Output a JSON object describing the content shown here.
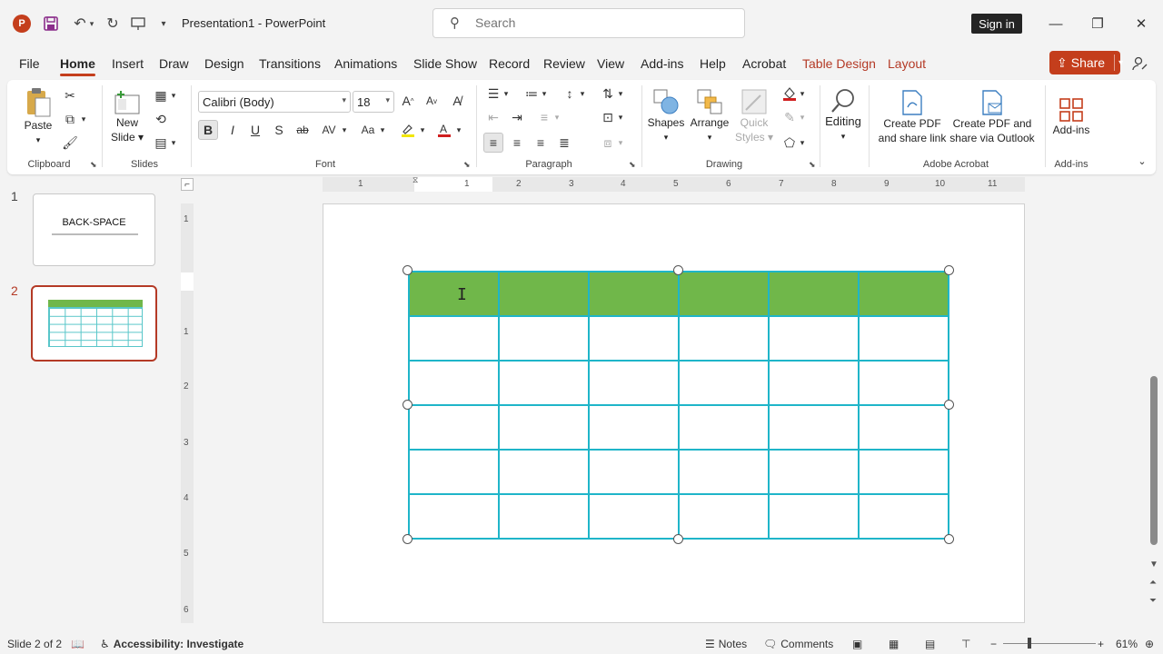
{
  "app": {
    "doc_title": "Presentation1  -  PowerPoint",
    "search_placeholder": "Search",
    "sign_in": "Sign in"
  },
  "tabs": [
    "File",
    "Home",
    "Insert",
    "Draw",
    "Design",
    "Transitions",
    "Animations",
    "Slide Show",
    "Record",
    "Review",
    "View",
    "Add-ins",
    "Help",
    "Acrobat",
    "Table Design",
    "Layout"
  ],
  "active_tab": "Home",
  "share_label": "Share",
  "ribbon": {
    "clipboard": {
      "paste": "Paste",
      "label": "Clipboard"
    },
    "slides": {
      "new_slide": "New",
      "new_slide2": "Slide",
      "label": "Slides"
    },
    "font": {
      "font_name": "Calibri (Body)",
      "font_size": "18",
      "bold": "B",
      "italic": "I",
      "underline": "U",
      "strike": "S",
      "abc": "ab",
      "spacing": "AV",
      "case": "Aa",
      "label": "Font"
    },
    "paragraph": {
      "label": "Paragraph"
    },
    "drawing": {
      "shapes": "Shapes",
      "arrange": "Arrange",
      "quick": "Quick",
      "styles": "Styles",
      "label": "Drawing"
    },
    "editing": {
      "editing": "Editing"
    },
    "acrobat": {
      "create_pdf_1": "Create PDF",
      "create_pdf_2": "and share link",
      "create_pdf_outlook_1": "Create PDF and",
      "create_pdf_outlook_2": "share via Outlook",
      "label": "Adobe Acrobat"
    },
    "addins": {
      "addins": "Add-ins",
      "label": "Add-ins"
    }
  },
  "thumbnails": [
    {
      "num": "1",
      "title": "BACK-SPACE"
    },
    {
      "num": "2"
    }
  ],
  "ruler_h": [
    "1",
    "1",
    "2",
    "3",
    "4",
    "5",
    "6",
    "7",
    "8",
    "9",
    "10",
    "11"
  ],
  "ruler_v": [
    "1",
    "1",
    "2",
    "3",
    "4",
    "5",
    "6"
  ],
  "status": {
    "slide_info": "Slide 2 of 2",
    "accessibility": "Accessibility: Investigate",
    "notes": "Notes",
    "comments": "Comments",
    "zoom": "61%"
  },
  "colors": {
    "accent": "#c43e1c",
    "table_header": "#70b74a",
    "table_border": "#1fb5c9"
  }
}
